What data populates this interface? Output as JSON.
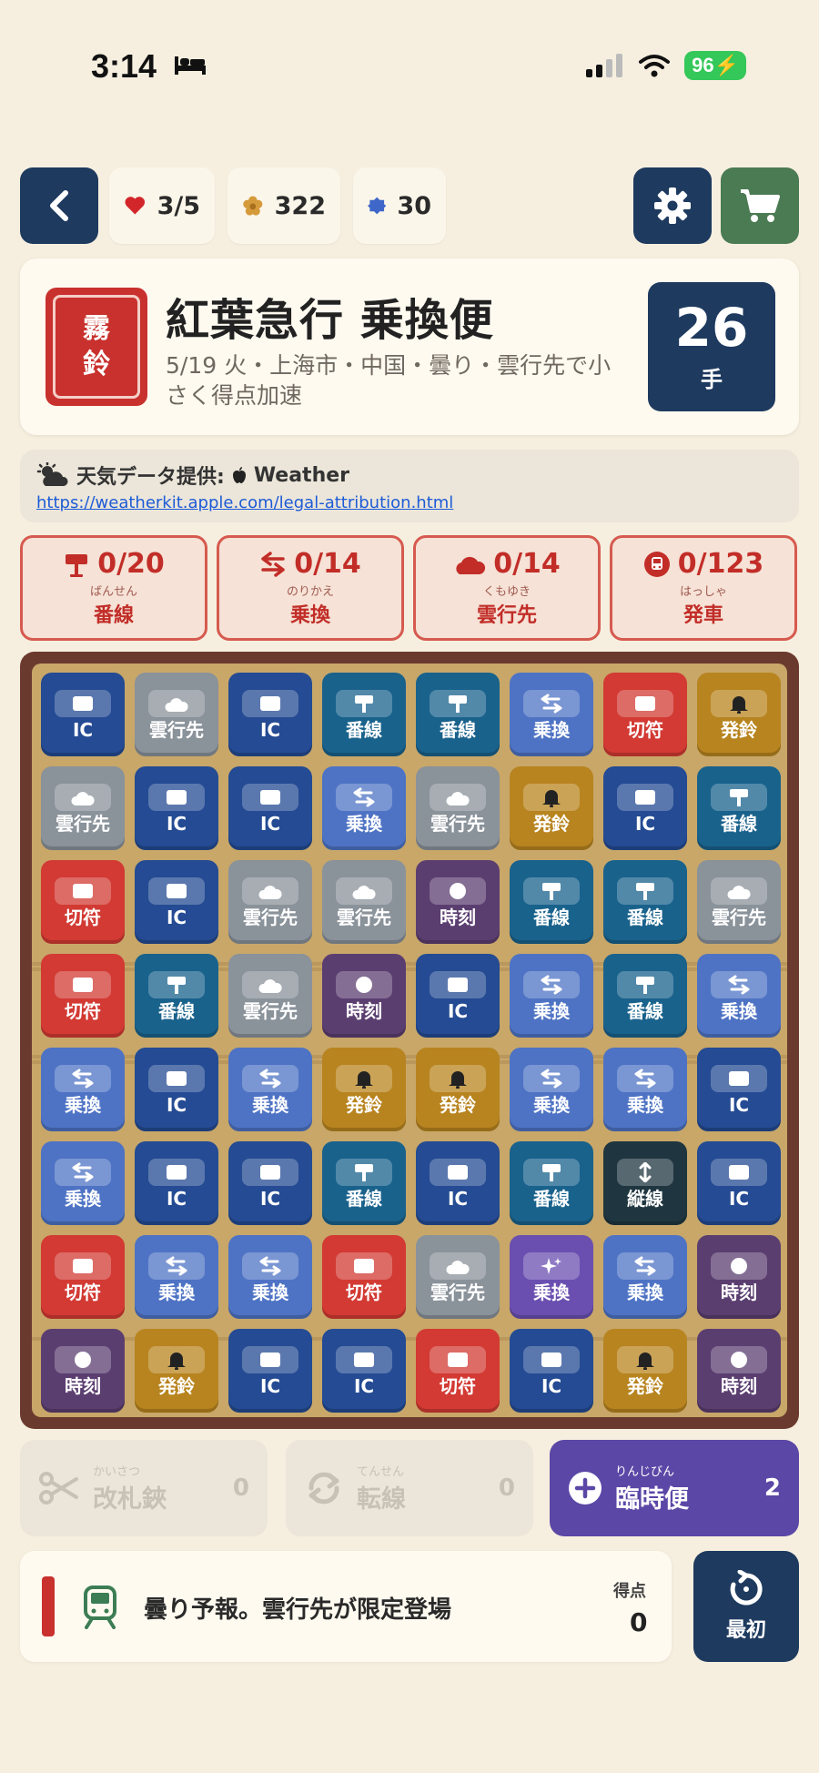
{
  "status_bar": {
    "time": "3:14",
    "battery": "96"
  },
  "top_bar": {
    "hearts": "3/5",
    "coins": "322",
    "gems": "30"
  },
  "header": {
    "seal_chars": [
      "霧",
      "鈴"
    ],
    "title": "紅葉急行 乗換便",
    "subtitle": "5/19 火・上海市・中国・曇り・雲行先で小さく得点加速",
    "moves": "26",
    "moves_label": "手"
  },
  "weather": {
    "attribution_prefix": "天気データ提供:",
    "attribution_brand": "Weather",
    "link": "https://weatherkit.apple.com/legal-attribution.html"
  },
  "goals": [
    {
      "icon": "signpost-icon",
      "progress": "0/20",
      "ruby": "ばんせん",
      "label": "番線"
    },
    {
      "icon": "transfer-icon",
      "progress": "0/14",
      "ruby": "のりかえ",
      "label": "乗換"
    },
    {
      "icon": "cloud-icon",
      "progress": "0/14",
      "ruby": "くもゆき",
      "label": "雲行先"
    },
    {
      "icon": "train-icon",
      "progress": "0/123",
      "ruby": "はっしゃ",
      "label": "発車"
    }
  ],
  "tile_types": {
    "ic": {
      "label": "IC",
      "icon": "ic-card-icon"
    },
    "cloud": {
      "label": "雲行先",
      "icon": "cloud-icon"
    },
    "plat": {
      "label": "番線",
      "icon": "signpost-icon"
    },
    "xfer": {
      "label": "乗換",
      "icon": "transfer-icon"
    },
    "bell": {
      "label": "発鈴",
      "icon": "bell-icon"
    },
    "ticket": {
      "label": "切符",
      "icon": "ticket-icon"
    },
    "clock": {
      "label": "時刻",
      "icon": "clock-icon"
    },
    "vert": {
      "label": "縦線",
      "icon": "vertical-arrows-icon"
    },
    "spark": {
      "label": "乗換",
      "icon": "sparkle-icon"
    }
  },
  "board": [
    [
      "ic",
      "cloud",
      "ic",
      "plat",
      "plat",
      "xfer",
      "ticket",
      "bell"
    ],
    [
      "cloud",
      "ic",
      "ic",
      "xfer",
      "cloud",
      "bell",
      "ic",
      "plat"
    ],
    [
      "ticket",
      "ic",
      "cloud",
      "cloud",
      "clock",
      "plat",
      "plat",
      "cloud"
    ],
    [
      "ticket",
      "plat",
      "cloud",
      "clock",
      "ic",
      "xfer",
      "plat",
      "xfer"
    ],
    [
      "xfer",
      "ic",
      "xfer",
      "bell",
      "bell",
      "xfer",
      "xfer",
      "ic"
    ],
    [
      "xfer",
      "ic",
      "ic",
      "plat",
      "ic",
      "plat",
      "vert",
      "ic"
    ],
    [
      "ticket",
      "xfer",
      "xfer",
      "ticket",
      "cloud",
      "spark",
      "xfer",
      "clock"
    ],
    [
      "clock",
      "bell",
      "ic",
      "ic",
      "ticket",
      "ic",
      "bell",
      "clock"
    ]
  ],
  "powerups": [
    {
      "ruby": "かいさつ",
      "label": "改札鋏",
      "count": "0",
      "icon": "scissors-icon"
    },
    {
      "ruby": "てんせん",
      "label": "転線",
      "count": "0",
      "icon": "cycle-icon"
    },
    {
      "ruby": "りんじびん",
      "label": "臨時便",
      "count": "2",
      "icon": "plus-icon"
    }
  ],
  "message": {
    "text": "曇り予報。雲行先が限定登場",
    "score_label": "得点",
    "score": "0"
  },
  "restart_label": "最初",
  "colors": {
    "navy": "#1e3a5f",
    "green": "#4b7b53",
    "red": "#c8312d",
    "purple": "#5b47a6"
  }
}
